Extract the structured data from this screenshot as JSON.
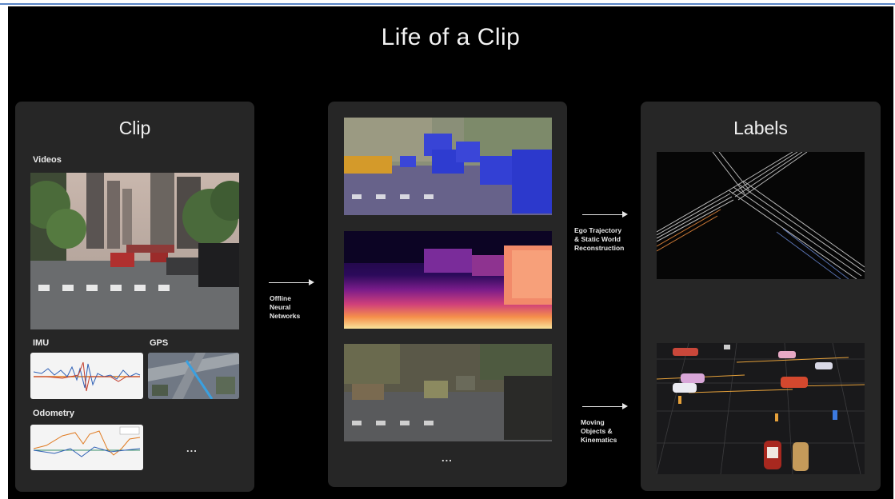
{
  "title": "Life of a Clip",
  "clip_panel": {
    "title": "Clip",
    "videos_label": "Videos",
    "imu_label": "IMU",
    "gps_label": "GPS",
    "odometry_label": "Odometry",
    "more": "..."
  },
  "middle_panel": {
    "more": "..."
  },
  "labels_panel": {
    "title": "Labels"
  },
  "arrows": {
    "offline_nn": [
      "Offline",
      "Neural",
      "Networks"
    ],
    "ego": [
      "Ego Trajectory",
      "& Static World",
      "Reconstruction"
    ],
    "moving": [
      "Moving",
      "Objects &",
      "Kinematics"
    ]
  }
}
